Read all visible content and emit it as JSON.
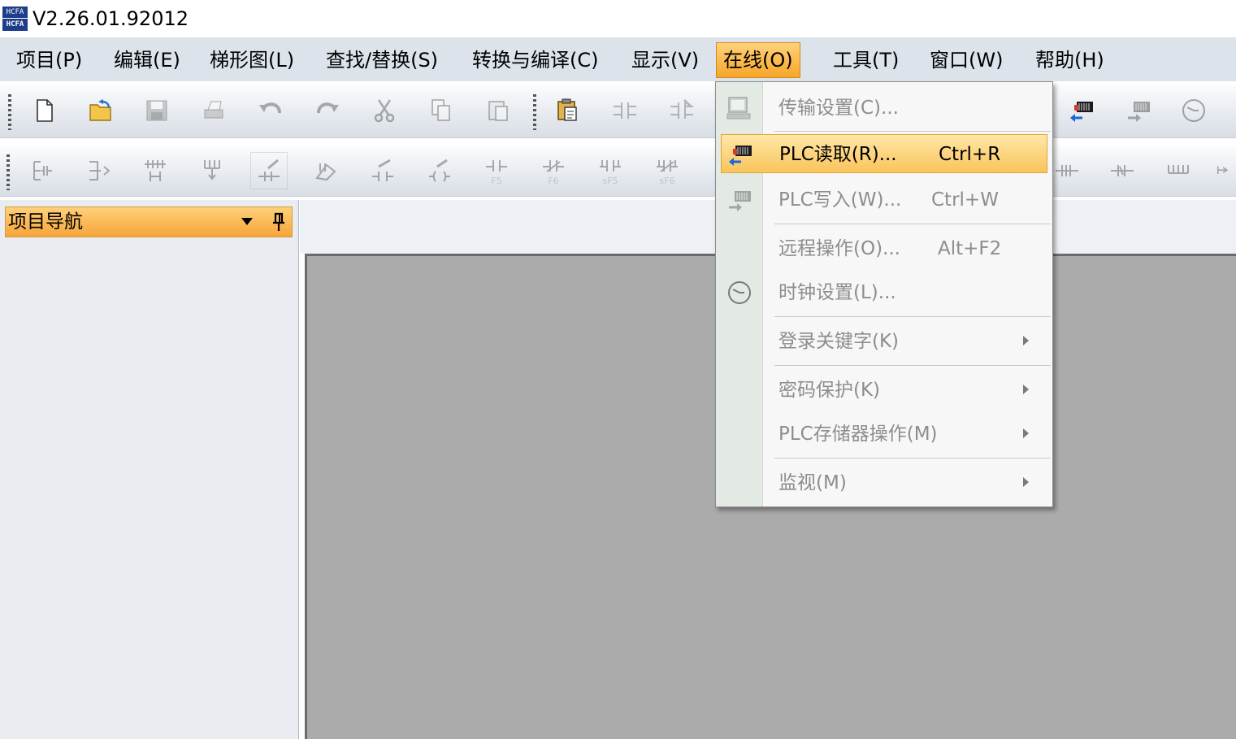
{
  "title": "V2.26.01.92012",
  "logo": {
    "line1": "HCFA",
    "line2": "HCFA"
  },
  "menubar": [
    {
      "label": "项目(P)"
    },
    {
      "label": "编辑(E)"
    },
    {
      "label": "梯形图(L)"
    },
    {
      "label": "查找/替换(S)"
    },
    {
      "label": "转换与编译(C)"
    },
    {
      "label": "显示(V)"
    },
    {
      "label": "在线(O)",
      "active": true
    },
    {
      "label": "工具(T)"
    },
    {
      "label": "窗口(W)"
    },
    {
      "label": "帮助(H)"
    }
  ],
  "toolbar1": {
    "icons": [
      "new-file-icon",
      "open-file-icon",
      "save-icon",
      "print-icon",
      "undo-icon",
      "redo-icon",
      "cut-icon",
      "copy-icon",
      "paste-icon",
      "paste-special-icon",
      "convert-icon",
      "compile-icon",
      "plc-read-icon",
      "plc-write-icon",
      "clock-icon"
    ]
  },
  "toolbar2": {
    "labels": {
      "f5": "F5",
      "f6": "F6",
      "sf5": "sF5",
      "sf6": "sF6"
    }
  },
  "nav": {
    "title": "项目导航"
  },
  "online_menu": {
    "items": [
      {
        "label": "传输设置(C)...",
        "shortcut": "",
        "icon": "transfer-settings-icon",
        "enabled": false
      },
      {
        "label": "PLC读取(R)...",
        "shortcut": "Ctrl+R",
        "icon": "plc-read-icon",
        "highlighted": true
      },
      {
        "label": "PLC写入(W)...",
        "shortcut": "Ctrl+W",
        "icon": "plc-write-icon",
        "enabled": false
      },
      {
        "label": "远程操作(O)...",
        "shortcut": "Alt+F2",
        "icon": "",
        "enabled": false
      },
      {
        "label": "时钟设置(L)...",
        "shortcut": "",
        "icon": "clock-icon",
        "enabled": false
      },
      {
        "label": "登录关键字(K)",
        "submenu": true,
        "enabled": false
      },
      {
        "label": "密码保护(K)",
        "submenu": true,
        "enabled": false
      },
      {
        "label": "PLC存储器操作(M)",
        "submenu": true,
        "enabled": false
      },
      {
        "label": "监视(M)",
        "submenu": true,
        "enabled": false
      }
    ]
  },
  "colors": {
    "highlight": "#f9c45a",
    "menubar": "#dde3eb",
    "workspace": "#ababab",
    "nav_header": "#f6a43a"
  }
}
